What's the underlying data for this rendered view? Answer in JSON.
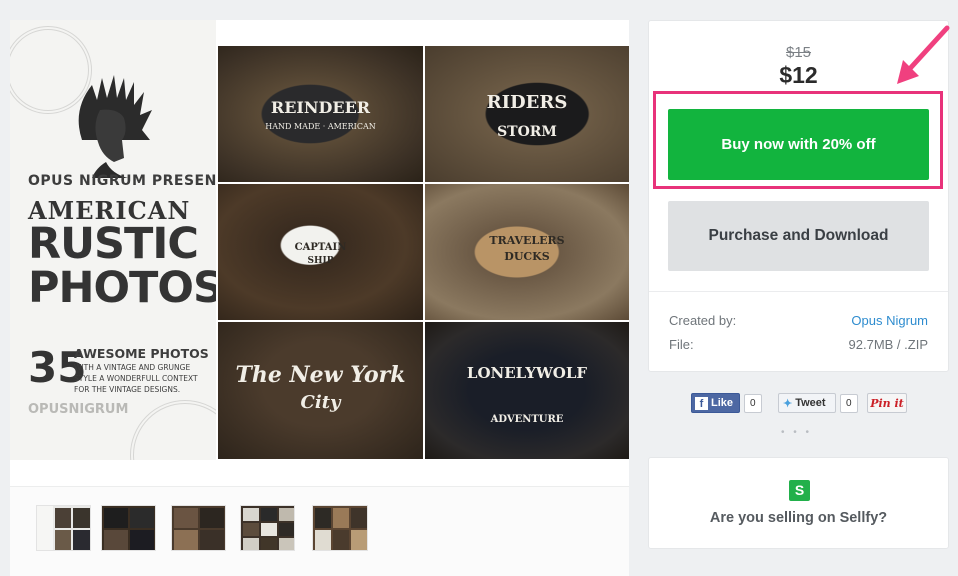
{
  "product": {
    "poster": {
      "line1": "OPUS NIGRUM PRESENTS",
      "line2": "AMERICAN",
      "line3": "RUSTIC",
      "line4": "PHOTOS",
      "number": "35",
      "subtitle": "AWESOME PHOTOS",
      "description": "WITH A VINTAGE AND GRUNGE STYLE A WONDERFULL CONTEXT FOR THE VINTAGE DESIGNS.",
      "signature": "OPUSNIGRUM"
    },
    "tiles": [
      {
        "title": "REINDEER",
        "sub": "HAND MADE · AMERICAN"
      },
      {
        "title": "RIDERS",
        "sub": "STORM"
      },
      {
        "title": "CAPTAIN",
        "sub": "SHIP"
      },
      {
        "title": "TRAVELERS",
        "sub": "DUCKS"
      },
      {
        "title": "The New York",
        "sub": "City"
      },
      {
        "title": "LONELYWOLF",
        "sub": "ADVENTURE"
      }
    ]
  },
  "pricing": {
    "old_price": "$15",
    "price": "$12",
    "buy_label": "Buy now with 20% off",
    "purchase_label": "Purchase and Download"
  },
  "details": {
    "created_label": "Created by:",
    "created_value": "Opus Nigrum",
    "file_label": "File:",
    "file_value": "92.7MB / .ZIP"
  },
  "social": {
    "like_label": "Like",
    "like_count": "0",
    "tweet_label": "Tweet",
    "tweet_count": "0",
    "pin_label": "Pin it",
    "more": "• • •"
  },
  "sellfy": {
    "logo_letter": "S",
    "question": "Are you selling on Sellfy?"
  },
  "colors": {
    "buy_green": "#12b43e",
    "highlight_pink": "#e8327a",
    "link_blue": "#2e8ccf",
    "facebook_blue": "#3b5998",
    "twitter_blue": "#4aa0dd",
    "pinterest_red": "#cb2027"
  }
}
